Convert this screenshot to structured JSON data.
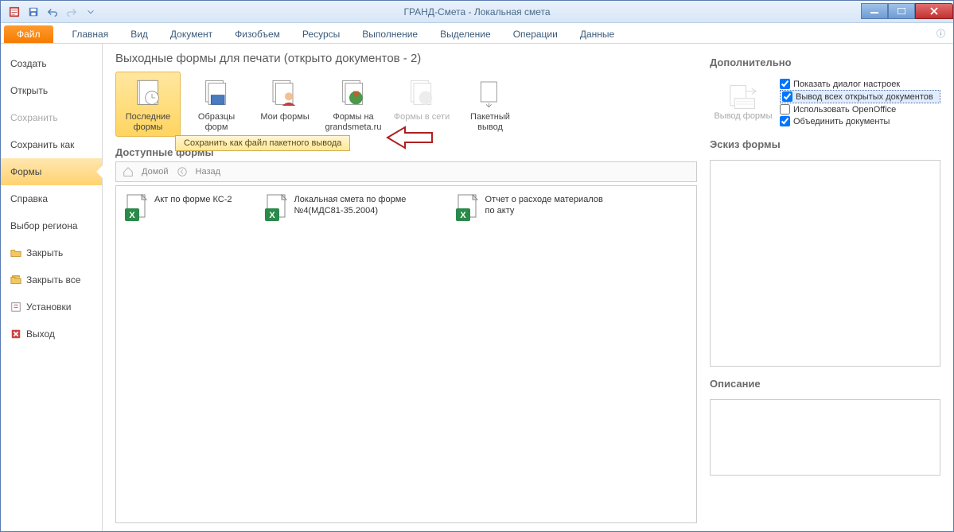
{
  "window": {
    "title": "ГРАНД-Смета - Локальная смета"
  },
  "ribbon": {
    "file": "Файл",
    "tabs": [
      "Главная",
      "Вид",
      "Документ",
      "Физобъем",
      "Ресурсы",
      "Выполнение",
      "Выделение",
      "Операции",
      "Данные"
    ]
  },
  "backstage": {
    "items": [
      {
        "label": "Создать"
      },
      {
        "label": "Открыть"
      },
      {
        "label": "Сохранить",
        "disabled": true
      },
      {
        "label": "Сохранить как"
      },
      {
        "label": "Формы",
        "active": true
      },
      {
        "label": "Справка"
      },
      {
        "label": "Выбор региона"
      },
      {
        "label": "Закрыть",
        "icon": "folder"
      },
      {
        "label": "Закрыть все",
        "icon": "folder"
      },
      {
        "label": "Установки",
        "icon": "tool"
      },
      {
        "label": "Выход",
        "icon": "exit"
      }
    ]
  },
  "main": {
    "heading": "Выходные формы для печати (открыто документов - 2)",
    "big_buttons": [
      {
        "label": "Последние формы",
        "selected": true
      },
      {
        "label": "Образцы форм"
      },
      {
        "label": "Мои формы"
      },
      {
        "label": "Формы на grandsmeta.ru"
      },
      {
        "label": "Формы в сети",
        "disabled": true
      },
      {
        "label": "Пакетный вывод"
      }
    ],
    "tooltip": "Сохранить как файл пакетного вывода",
    "available_heading": "Доступные формы",
    "crumbs": {
      "home": "Домой",
      "back": "Назад"
    },
    "forms": [
      {
        "label": "Акт по форме КС-2"
      },
      {
        "label": "Локальная смета по форме №4(МДС81-35.2004)"
      },
      {
        "label": "Отчет о расходе материалов по акту"
      }
    ]
  },
  "right": {
    "additional": "Дополнительно",
    "output_label": "Вывод формы",
    "checks": [
      {
        "label": "Показать диалог настроек",
        "checked": true
      },
      {
        "label": "Вывод всех открытых документов",
        "checked": true,
        "hl": true
      },
      {
        "label": "Использовать OpenOffice",
        "checked": false
      },
      {
        "label": "Объединить документы",
        "checked": true
      }
    ],
    "sketch": "Эскиз формы",
    "desc": "Описание"
  }
}
